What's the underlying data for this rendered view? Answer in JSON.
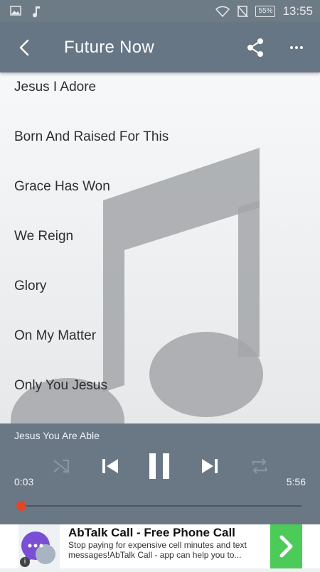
{
  "status_bar": {
    "time": "13:55",
    "battery": "55%"
  },
  "app_bar": {
    "title": "Future Now"
  },
  "tracks": [
    "Jesus I Adore",
    "Born And Raised For This",
    "Grace Has Won",
    "We Reign",
    "Glory",
    "On My Matter",
    "Only You Jesus"
  ],
  "player": {
    "now_playing": "Jesus You Are Able",
    "elapsed": "0:03",
    "duration": "5:56",
    "progress_fraction": 0.009
  },
  "ad": {
    "headline": "AbTalk Call - Free Phone Call",
    "body": "Stop paying for expensive cell minutes and text messages!AbTalk Call - app can help you to...",
    "info_label": "i",
    "accent_color": "#4ccb58"
  },
  "colors": {
    "app_bar": "#667685",
    "player": "#6a7885",
    "seek_accent": "#e0462b"
  }
}
